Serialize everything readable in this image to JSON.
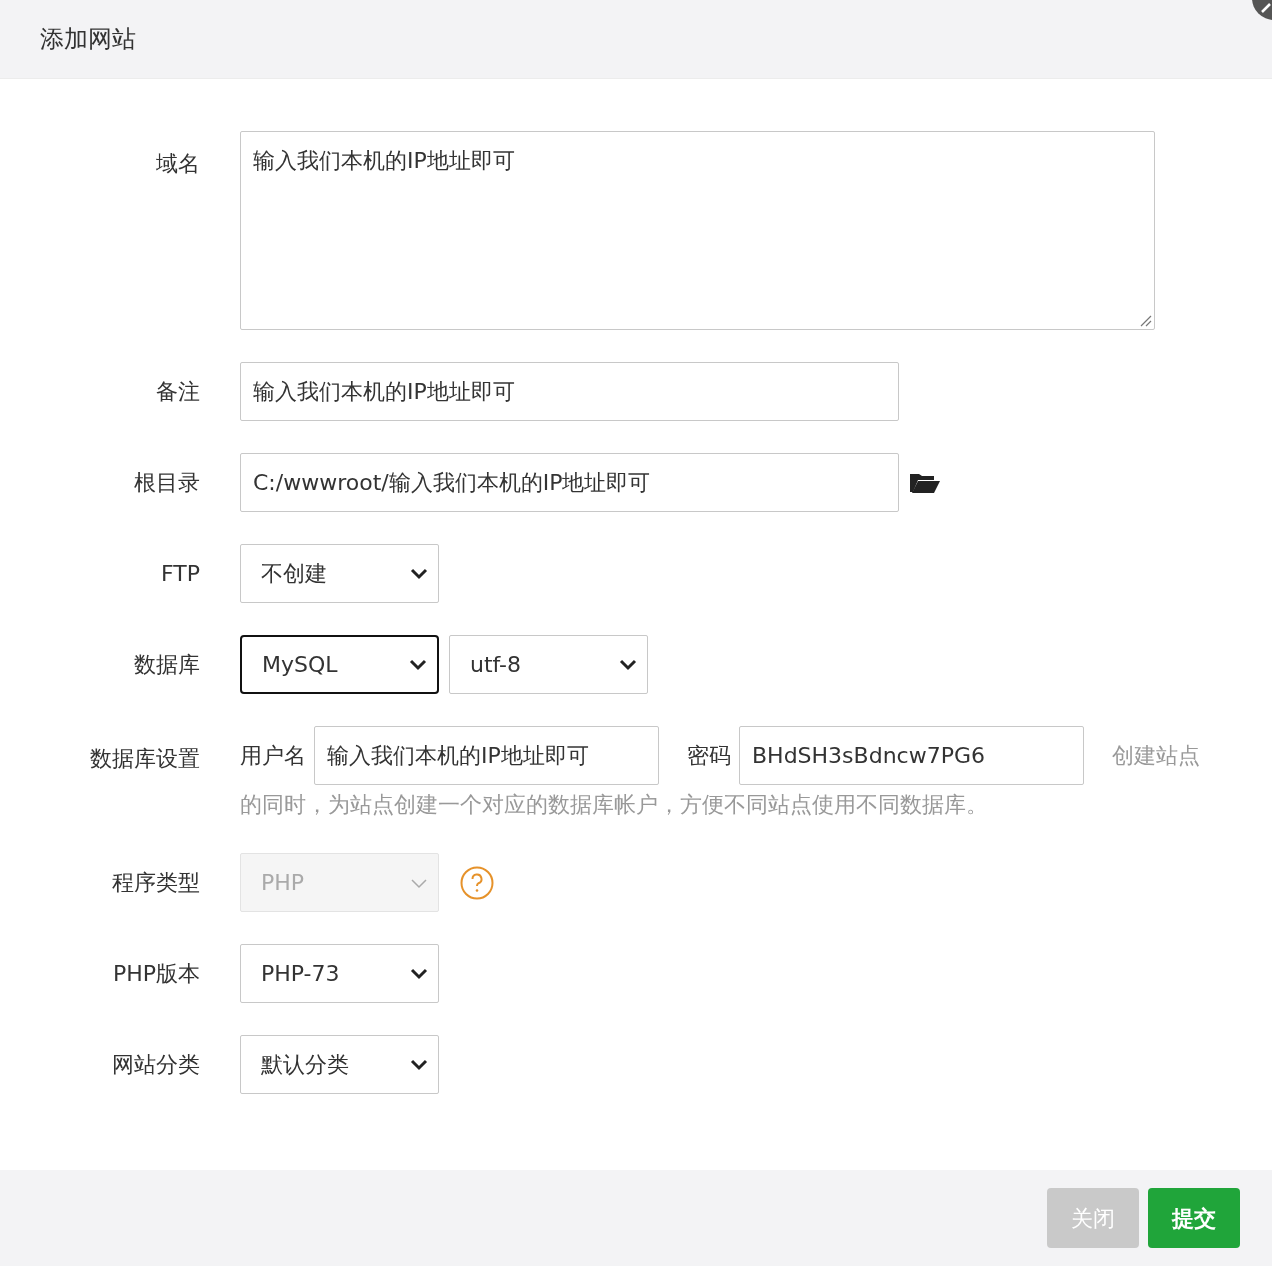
{
  "dialog": {
    "title": "添加网站"
  },
  "form": [
    {
      "label": "域名",
      "kind": "textarea",
      "value": "输入我们本机的IP地址即可"
    },
    {
      "label": "备注",
      "kind": "text",
      "value": "输入我们本机的IP地址即可"
    },
    {
      "label": "根目录",
      "kind": "path",
      "value": "C:/wwwroot/输入我们本机的IP地址即可"
    },
    {
      "label": "FTP",
      "kind": "select",
      "selects": [
        {
          "value": "不创建",
          "focused": false,
          "disabled": false
        }
      ]
    },
    {
      "label": "数据库",
      "kind": "select",
      "selects": [
        {
          "value": "MySQL",
          "focused": true,
          "disabled": false
        },
        {
          "value": "utf-8",
          "focused": false,
          "disabled": false
        }
      ]
    },
    {
      "label": "数据库设置",
      "kind": "credentials",
      "username_label": "用户名",
      "username": "输入我们本机的IP地址即可",
      "password_label": "密码",
      "password": "BHdSH3sBdncw7PG6",
      "hint_line_1": "创建站点",
      "hint_line_2": "的同时，为站点创建一个对应的数据库帐户，方便不同站点使用不同数据库。"
    },
    {
      "label": "程序类型",
      "kind": "select",
      "help": true,
      "selects": [
        {
          "value": "PHP",
          "focused": false,
          "disabled": true
        }
      ]
    },
    {
      "label": "PHP版本",
      "kind": "select",
      "selects": [
        {
          "value": "PHP-73",
          "focused": false,
          "disabled": false
        }
      ]
    },
    {
      "label": "网站分类",
      "kind": "select",
      "selects": [
        {
          "value": "默认分类",
          "focused": false,
          "disabled": false
        }
      ]
    }
  ],
  "buttons": [
    {
      "label": "关闭",
      "kind": "secondary"
    },
    {
      "label": "提交",
      "kind": "primary"
    }
  ]
}
